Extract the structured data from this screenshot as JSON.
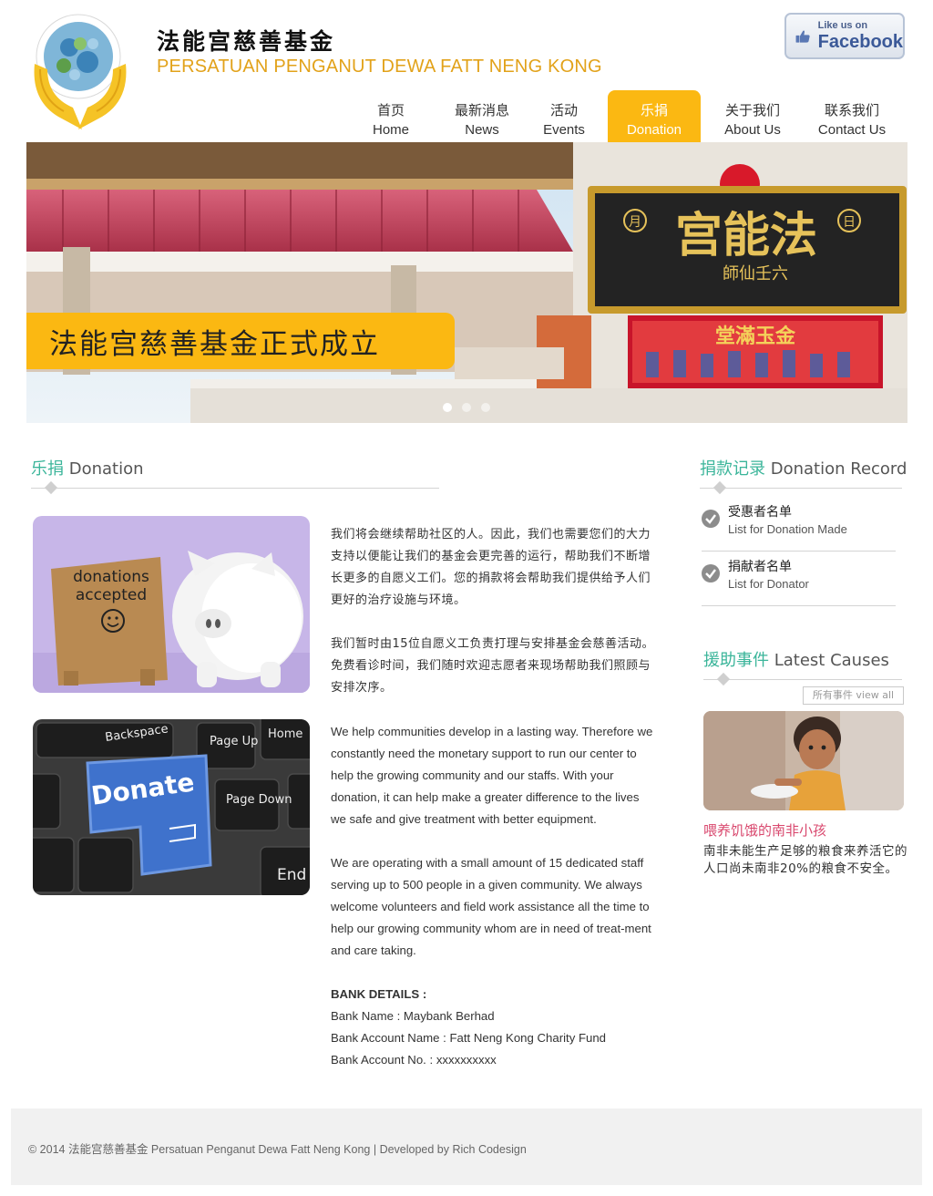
{
  "header": {
    "title_cn": "法能宫慈善基金",
    "title_en": "PERSATUAN PENGANUT DEWA FATT NENG KONG",
    "facebook": {
      "like_text": "Like us on",
      "name": "Facebook"
    }
  },
  "nav": {
    "items": [
      {
        "cn": "首页",
        "en": "Home"
      },
      {
        "cn": "最新消息",
        "en": "News"
      },
      {
        "cn": "活动",
        "en": "Events"
      },
      {
        "cn": "乐捐",
        "en": "Donation"
      },
      {
        "cn": "关于我们",
        "en": "About Us"
      },
      {
        "cn": "联系我们",
        "en": "Contact Us"
      }
    ],
    "active": "Donation"
  },
  "banner": {
    "caption": "法能宫慈善基金正式成立",
    "sign_text": "宫能法",
    "sign_sub": "師仙壬六",
    "sign_left": "月",
    "sign_right": "日",
    "red_sign": "堂滿玉金",
    "slides": 3,
    "current_slide": 1
  },
  "main": {
    "heading_cn": "乐捐",
    "heading_en": "Donation",
    "images": {
      "piggy_sign_line1": "donations",
      "piggy_sign_line2": "accepted",
      "key_label": "Donate",
      "key_backspace": "Backspace",
      "key_home": "Home",
      "key_pageup": "Page Up",
      "key_pagedown": "Page Down",
      "key_end": "End"
    },
    "para_cn_1": "我们将会继续帮助社区的人。因此，我们也需要您们的大力支持以便能让我们的基金会更完善的运行，帮助我们不断增长更多的自愿义工们。您的捐款将会帮助我们提供给予人们更好的治疗设施与环境。",
    "para_cn_2": "我们暂时由15位自愿义工负责打理与安排基金会慈善活动。免费看诊时间，我们随时欢迎志愿者来现场帮助我们照顾与安排次序。",
    "para_en_1": "We help communities develop in a lasting way. Therefore we constantly need the monetary support to run our center to help the growing community and our staffs. With your donation, it can help make a greater difference to the lives we safe and give treatment with better equipment.",
    "para_en_2": "We are operating with a small amount of 15 dedicated staff serving up to 500 people in a given community. We always welcome volunteers and field work assistance all the time to help our growing community whom are in need of treat-ment and care taking.",
    "bank": {
      "heading": "BANK DETAILS :",
      "name": "Bank Name : Maybank Berhad",
      "account_name": "Bank Account Name : Fatt Neng Kong Charity Fund",
      "account_no": "Bank Account No. : xxxxxxxxxx"
    }
  },
  "sidebar": {
    "record_heading_cn": "捐款记录",
    "record_heading_en": "Donation Record",
    "records": [
      {
        "cn": "受惠者名单",
        "en": "List for Donation Made"
      },
      {
        "cn": "捐献者名单",
        "en": "List for Donator"
      }
    ],
    "causes_heading_cn": "援助事件",
    "causes_heading_en": "Latest Causes",
    "view_all": "所有事件   view all",
    "cause_title": "喂养饥饿的南非小孩",
    "cause_text": "南非未能生产足够的粮食来养活它的人口尚未南非20%的粮食不安全。"
  },
  "footer": {
    "text": "© 2014 法能宫慈善基金  Persatuan Penganut Dewa Fatt Neng Kong  |   Developed by Rich Codesign"
  },
  "colors": {
    "accent": "#fbb812",
    "teal": "#3bb59a",
    "pink": "#d9486e",
    "facebook": "#3b5998"
  }
}
